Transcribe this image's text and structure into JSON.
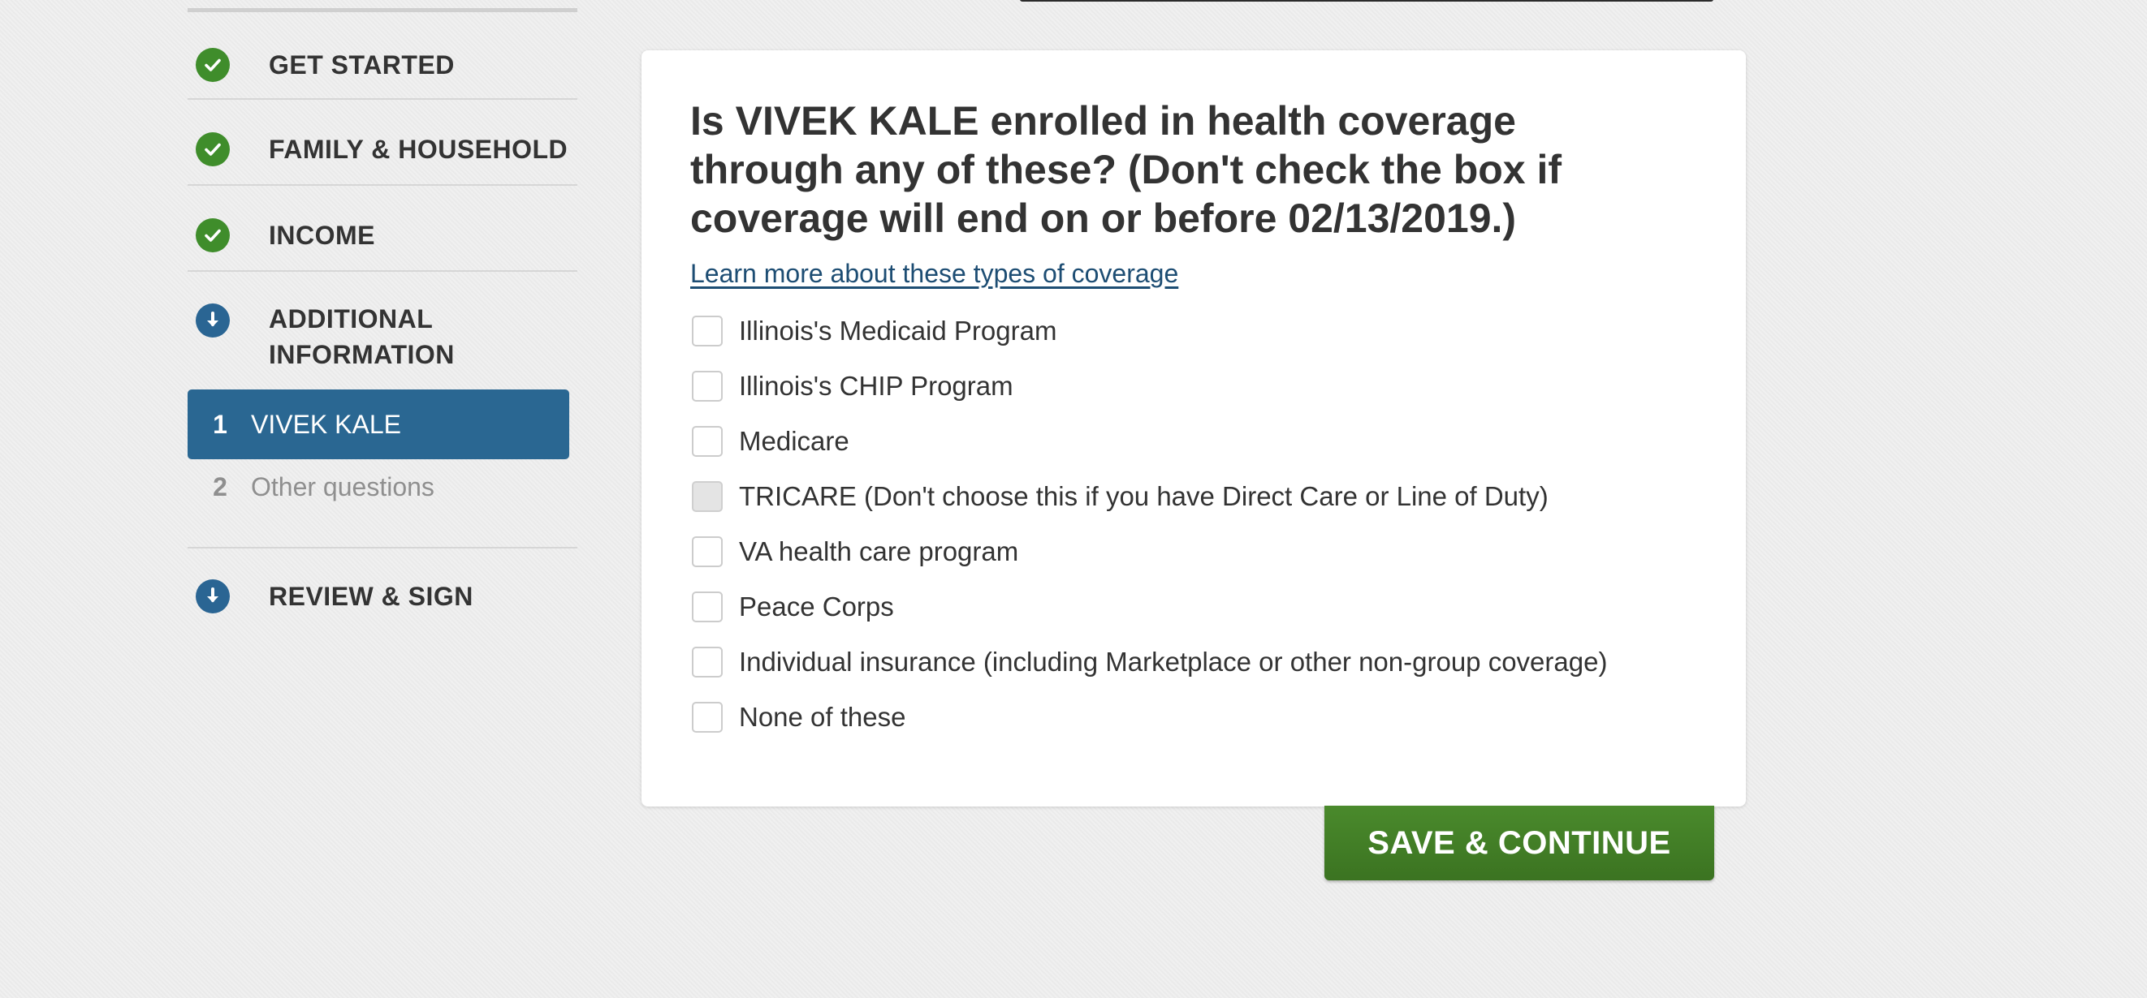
{
  "sidebar": {
    "steps": [
      {
        "label": "GET STARTED",
        "status": "complete",
        "icon": "check-circle-icon"
      },
      {
        "label": "FAMILY & HOUSEHOLD",
        "status": "complete",
        "icon": "check-circle-icon"
      },
      {
        "label": "INCOME",
        "status": "complete",
        "icon": "check-circle-icon"
      },
      {
        "label": "ADDITIONAL INFORMATION",
        "label_line1": "ADDITIONAL",
        "label_line2": "INFORMATION",
        "status": "current",
        "icon": "arrow-down-circle-icon"
      },
      {
        "label": "REVIEW & SIGN",
        "status": "upcoming",
        "icon": "arrow-down-circle-icon"
      }
    ],
    "substeps": [
      {
        "number": "1",
        "label": "VIVEK KALE",
        "active": true
      },
      {
        "number": "2",
        "label": "Other questions",
        "active": false
      }
    ]
  },
  "main": {
    "question": "Is VIVEK KALE enrolled in health coverage through any of these? (Don't check the box if coverage will end on or before 02/13/2019.)",
    "learn_more_link": "Learn more about these types of coverage",
    "options": [
      {
        "label": "Illinois's Medicaid Program",
        "checked": false,
        "disabled": false
      },
      {
        "label": "Illinois's CHIP Program",
        "checked": false,
        "disabled": false
      },
      {
        "label": "Medicare",
        "checked": false,
        "disabled": false
      },
      {
        "label": "TRICARE (Don't choose this if you have Direct Care or Line of Duty)",
        "checked": false,
        "disabled": true
      },
      {
        "label": "VA health care program",
        "checked": false,
        "disabled": false
      },
      {
        "label": "Peace Corps",
        "checked": false,
        "disabled": false
      },
      {
        "label": "Individual insurance (including Marketplace or other non-group coverage)",
        "checked": false,
        "disabled": false
      },
      {
        "label": "None of these",
        "checked": false,
        "disabled": false
      }
    ]
  },
  "actions": {
    "save_continue": "SAVE & CONTINUE"
  },
  "colors": {
    "complete": "#3f8d2b",
    "current": "#2a6593",
    "active_substep": "#2a6792",
    "save_button": "#3f7d26",
    "link": "#1d4d73"
  }
}
